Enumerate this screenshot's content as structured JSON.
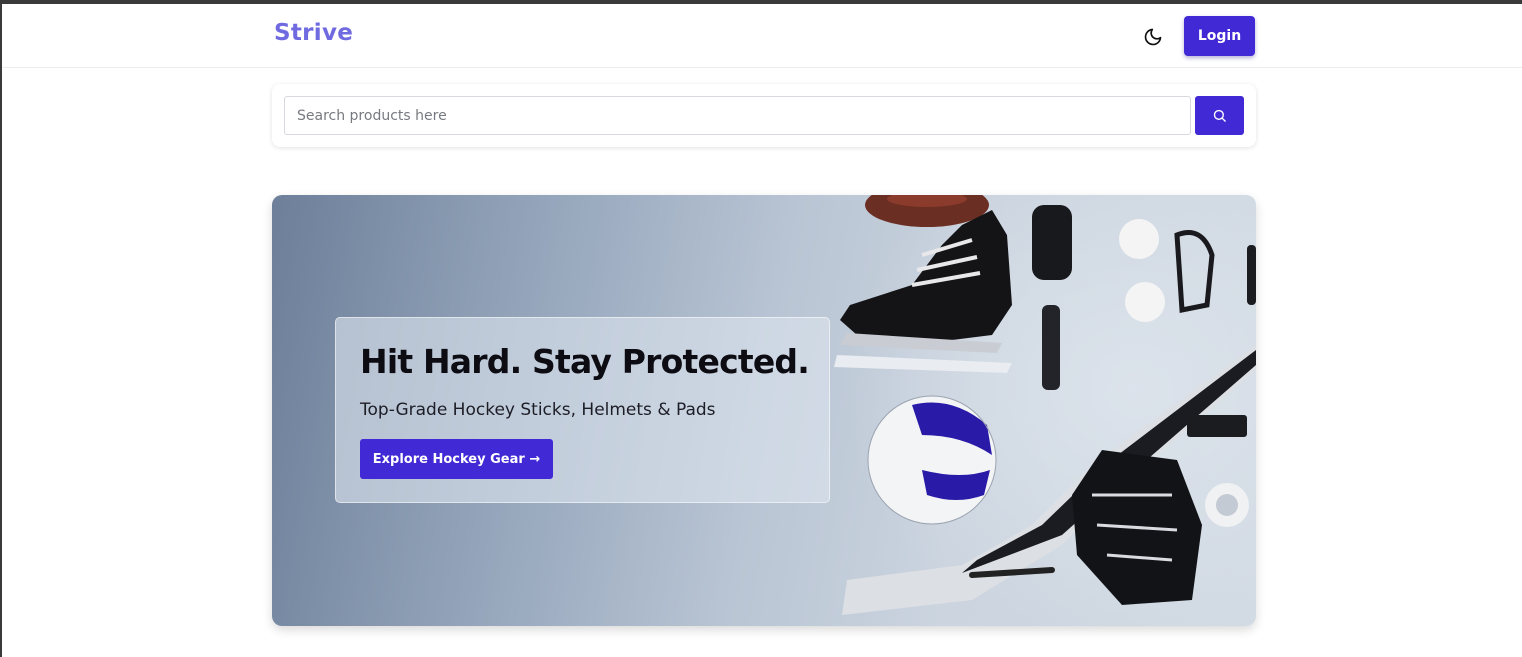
{
  "header": {
    "logo": "Strive",
    "login_label": "Login",
    "theme_toggle_icon": "moon-icon"
  },
  "search": {
    "placeholder": "Search products here",
    "value": "",
    "button_icon": "search-icon"
  },
  "hero": {
    "title": "Hit Hard. Stay Protected.",
    "subtitle": "Top-Grade Hockey Sticks, Helmets & Pads",
    "cta_label": "Explore Hockey Gear →",
    "image_subject": "hockey-gear-flat-lay"
  },
  "colors": {
    "accent": "#4229d6",
    "logo": "#6f6ae0"
  }
}
